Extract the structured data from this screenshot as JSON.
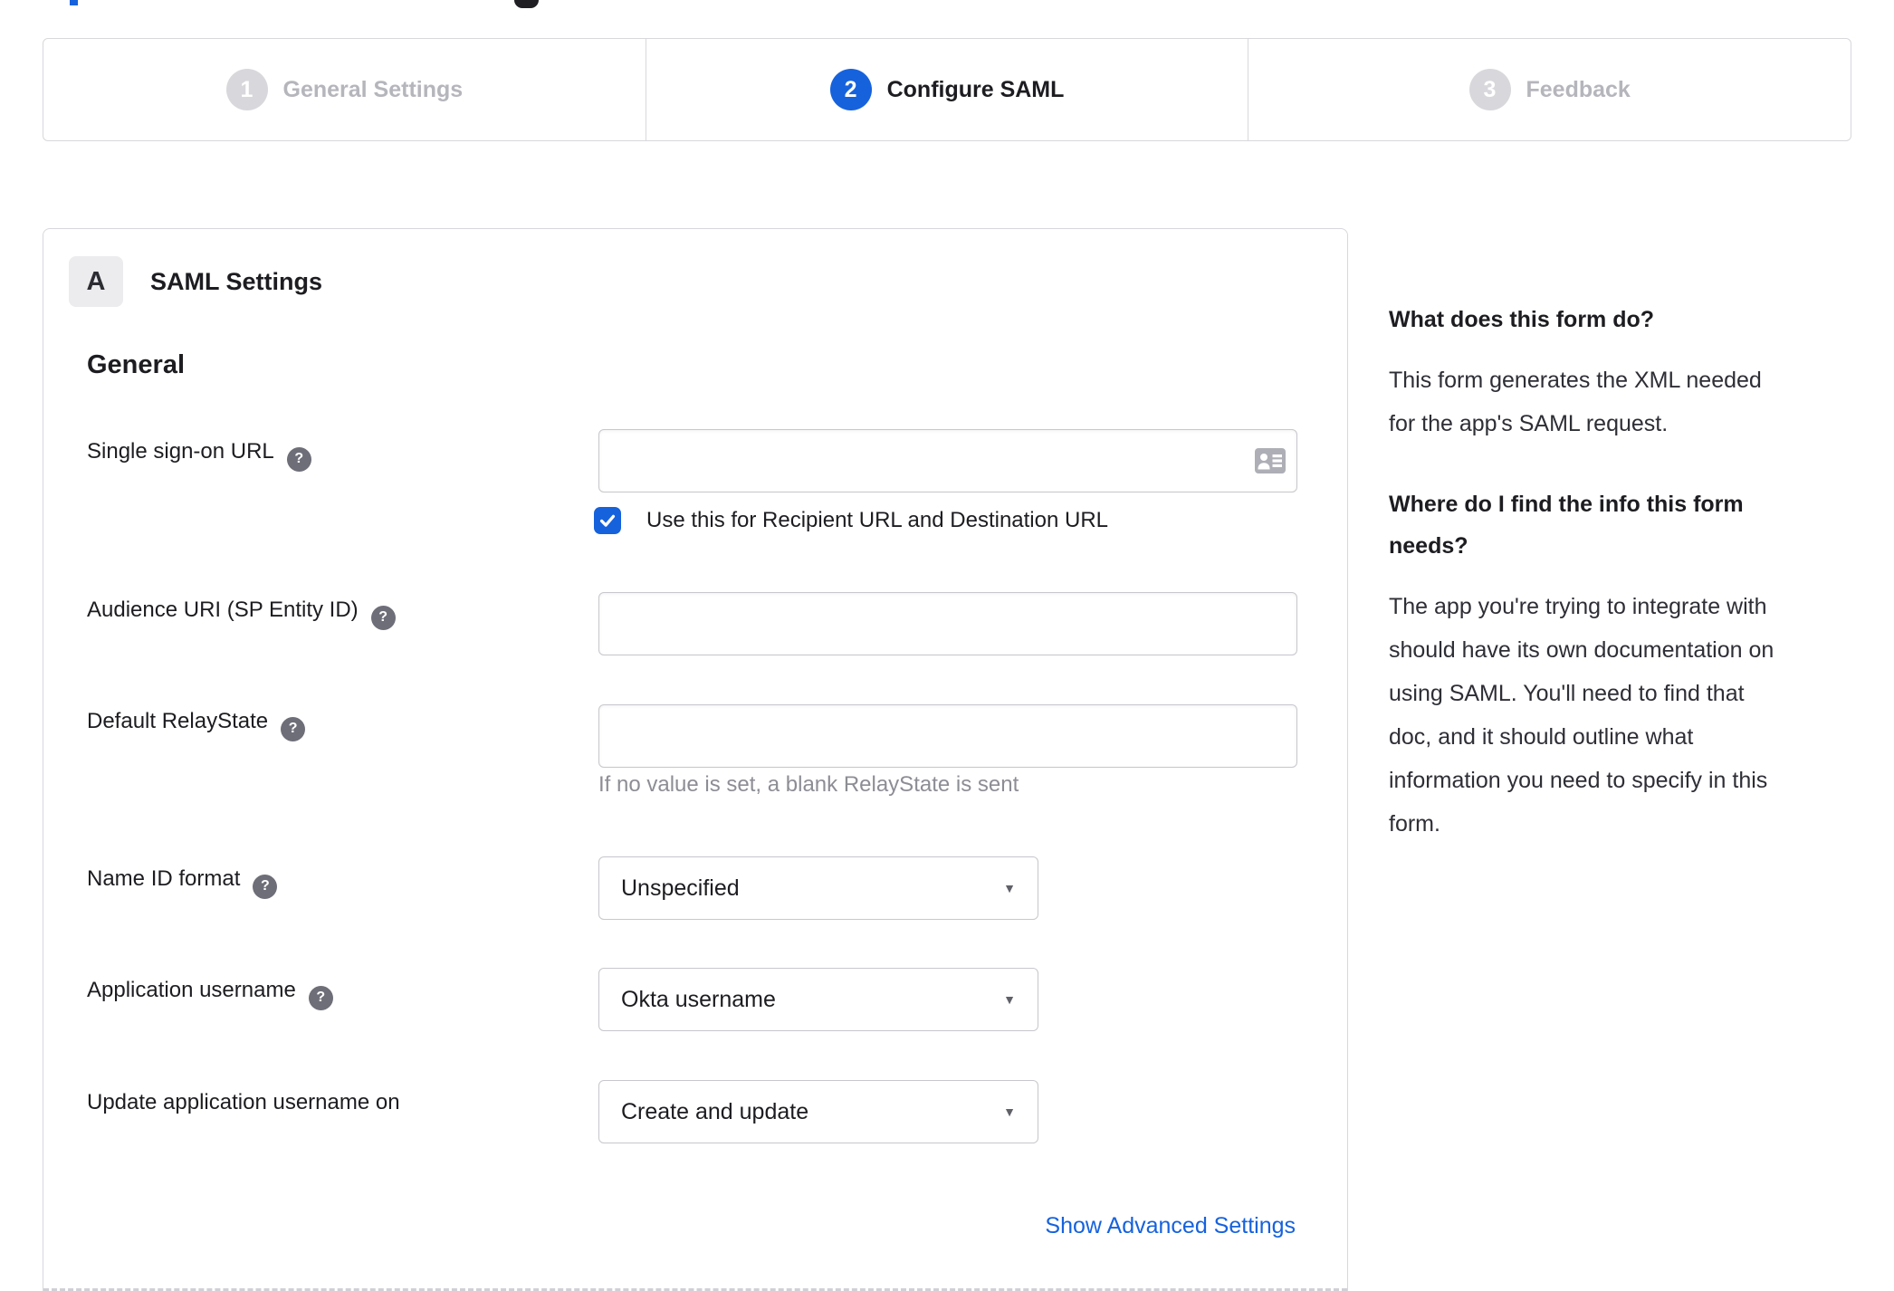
{
  "colors": {
    "accent_blue": "#1662dd",
    "dark_text": "#1d1d21",
    "inactive_gray": "#b5b5bc",
    "border_gray": "#d8d8dc",
    "help_icon_gray": "#6e6e78",
    "hint_gray": "#8d8d95"
  },
  "stepper": {
    "steps": [
      {
        "number": "1",
        "label": "General Settings",
        "active": false
      },
      {
        "number": "2",
        "label": "Configure SAML",
        "active": true
      },
      {
        "number": "3",
        "label": "Feedback",
        "active": false
      }
    ]
  },
  "panel": {
    "badge_label": "A",
    "title": "SAML Settings",
    "form": {
      "section_heading": "General",
      "sso": {
        "label": "Single sign-on URL",
        "value": ""
      },
      "sso_checkbox": {
        "label": "Use this for Recipient URL and Destination URL",
        "checked": true
      },
      "audience": {
        "label": "Audience URI (SP Entity ID)",
        "value": ""
      },
      "relay": {
        "label": "Default RelayState",
        "value": "",
        "hint": "If no value is set, a blank RelayState is sent"
      },
      "name_id": {
        "label": "Name ID format",
        "value": "Unspecified"
      },
      "app_username": {
        "label": "Application username",
        "value": "Okta username"
      },
      "update_username": {
        "label": "Update application username on",
        "value": "Create and update"
      },
      "advanced_link": "Show Advanced Settings"
    }
  },
  "sidebar": {
    "sections": [
      {
        "heading": "What does this form do?",
        "body": "This form generates the XML needed\nfor the app's SAML request."
      },
      {
        "heading": "Where do I find the info this form\nneeds?",
        "body": "The app you're trying to integrate with\nshould have its own documentation on\nusing SAML. You'll need to find that\ndoc, and it should outline what\ninformation you need to specify in this\nform."
      }
    ]
  }
}
